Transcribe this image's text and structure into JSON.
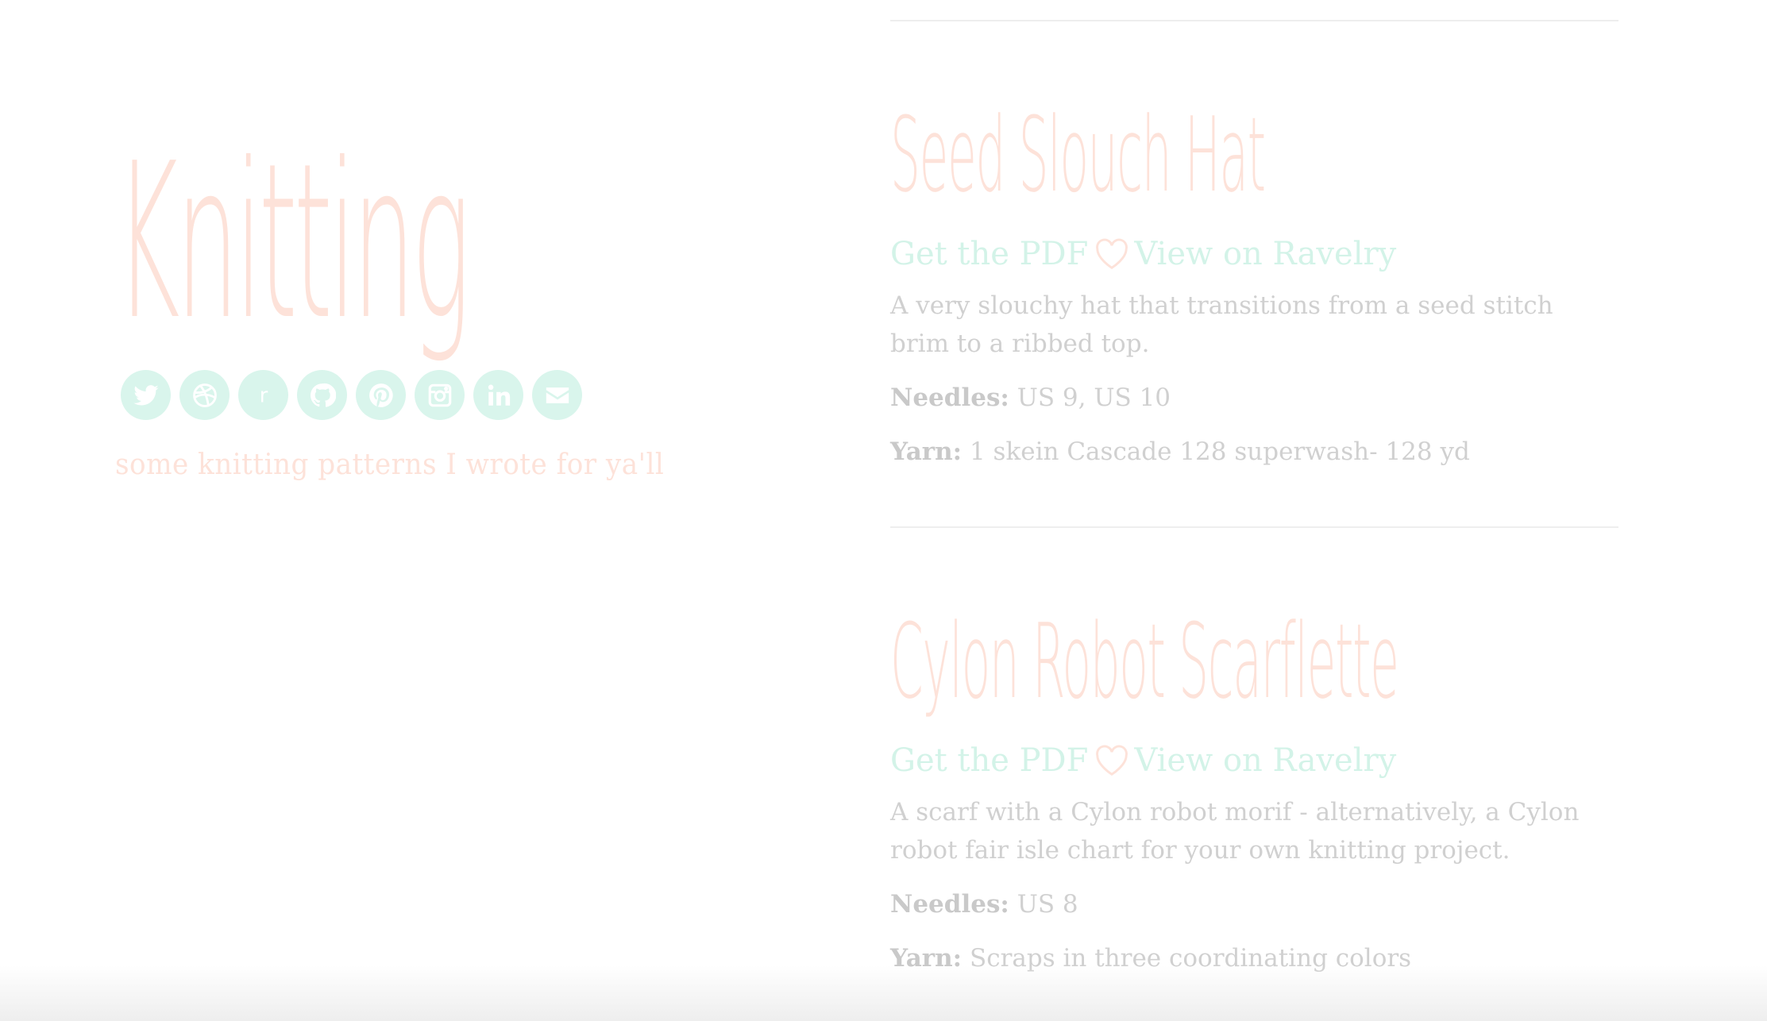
{
  "site": {
    "title": "Knitting",
    "tagline": "some knitting patterns I wrote for ya'll"
  },
  "social_links": [
    {
      "icon": "twitter-icon",
      "name": "twitter"
    },
    {
      "icon": "dribbble-icon",
      "name": "dribbble"
    },
    {
      "icon": "ravelry-icon",
      "name": "ravelry",
      "glyph": "r"
    },
    {
      "icon": "github-icon",
      "name": "github"
    },
    {
      "icon": "pinterest-icon",
      "name": "pinterest"
    },
    {
      "icon": "instagram-icon",
      "name": "instagram"
    },
    {
      "icon": "linkedin-icon",
      "name": "linkedin"
    },
    {
      "icon": "email-icon",
      "name": "email"
    }
  ],
  "patterns": [
    {
      "title": "Seed Slouch Hat",
      "pdf_label": "Get the PDF",
      "ravelry_label": "View on Ravelry",
      "description": "A very slouchy hat that transitions from a seed stitch brim to a ribbed top.",
      "needles_label": "Needles:",
      "needles": "US 9, US 10",
      "yarn_label": "Yarn:",
      "yarn": "1 skein Cascade 128 superwash- 128 yd"
    },
    {
      "title": "Cylon Robot Scarflette",
      "pdf_label": "Get the PDF",
      "ravelry_label": "View on Ravelry",
      "description": "A scarf with a Cylon robot morif - alternatively, a Cylon robot fair isle chart for your own knitting project.",
      "needles_label": "Needles:",
      "needles": "US 8",
      "yarn_label": "Yarn:",
      "yarn": "Scraps in three coordinating colors"
    }
  ],
  "colors": {
    "title_peach": "#fde2d9",
    "mint": "#d3f3e8",
    "text_gray": "#d0d0d0"
  }
}
